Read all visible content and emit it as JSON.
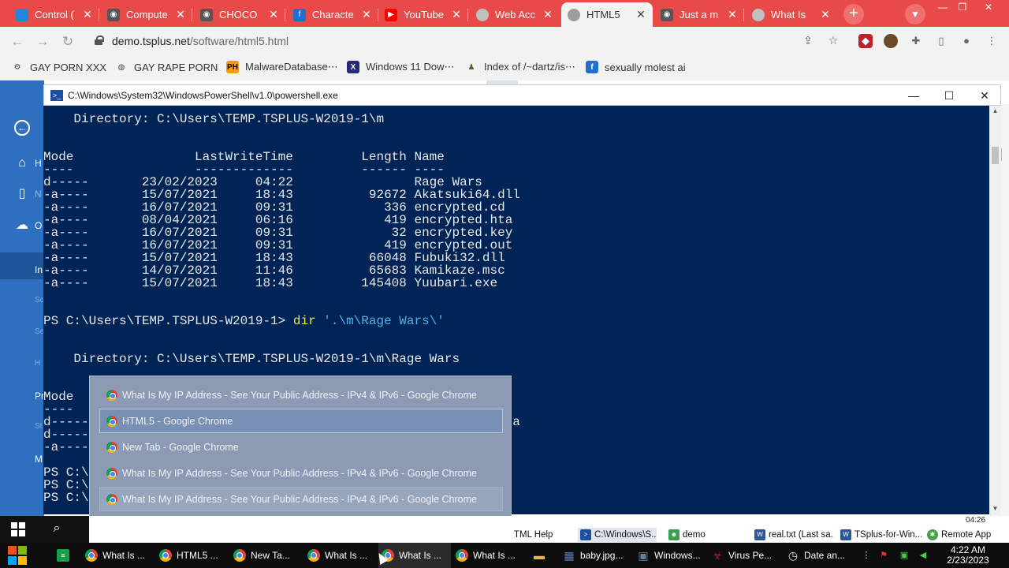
{
  "browser": {
    "tabs": [
      {
        "title": "Control (",
        "favicon_color": "#1f88d8",
        "active": false
      },
      {
        "title": "Compute",
        "favicon_color": "#555555",
        "active": false
      },
      {
        "title": "CHOCO",
        "favicon_color": "#555555",
        "active": false
      },
      {
        "title": "Characte",
        "favicon_color": "#1f6fd0",
        "active": false
      },
      {
        "title": "YouTube",
        "favicon_color": "#ff0000",
        "active": false
      },
      {
        "title": "Web Acc",
        "favicon_color": "#c0c0c0",
        "active": false
      },
      {
        "title": "HTML5",
        "favicon_color": "#9e9e9e",
        "active": true
      },
      {
        "title": "Just a m",
        "favicon_color": "#555555",
        "active": false
      },
      {
        "title": "What Is",
        "favicon_color": "#c0c0c0",
        "active": false
      }
    ],
    "new_tab_label": "+",
    "address": {
      "host": "demo.tsplus.net",
      "path": "/software/html5.html"
    },
    "bookmarks": [
      {
        "label": "GAY PORN XXX",
        "icon": "gear-icon"
      },
      {
        "label": "GAY RAPE PORN",
        "icon": "globe-icon"
      },
      {
        "label": "MalwareDatabase⋯",
        "icon": "ph-icon"
      },
      {
        "label": "Windows 11 Dow⋯",
        "icon": "x-icon"
      },
      {
        "label": "Index of /~dartz/is⋯",
        "icon": "figure-icon"
      },
      {
        "label": "sexually molest ai",
        "icon": "bookmark-icon"
      }
    ]
  },
  "remote_page": {
    "nav_labels": [
      "H",
      "N",
      "O",
      "In",
      "Sc",
      "Se",
      "H",
      "Pr",
      "St",
      "M"
    ]
  },
  "powershell": {
    "title": "C:\\Windows\\System32\\WindowsPowerShell\\v1.0\\powershell.exe",
    "lines": [
      {
        "text": "    Directory: C:\\Users\\TEMP.TSPLUS-W2019-1\\m"
      },
      {
        "text": ""
      },
      {
        "text": ""
      },
      {
        "text": "Mode                LastWriteTime         Length Name"
      },
      {
        "text": "----                -------------         ------ ----"
      },
      {
        "text": "d-----       23/02/2023     04:22                Rage Wars"
      },
      {
        "text": "-a----       15/07/2021     18:43          92672 Akatsuki64.dll"
      },
      {
        "text": "-a----       16/07/2021     09:31            336 encrypted.cd"
      },
      {
        "text": "-a----       08/04/2021     06:16            419 encrypted.hta"
      },
      {
        "text": "-a----       16/07/2021     09:31             32 encrypted.key"
      },
      {
        "text": "-a----       16/07/2021     09:31            419 encrypted.out"
      },
      {
        "text": "-a----       15/07/2021     18:43          66048 Fubuki32.dll"
      },
      {
        "text": "-a----       14/07/2021     11:46          65683 Kamikaze.msc"
      },
      {
        "text": "-a----       15/07/2021     18:43         145408 Yuubari.exe"
      },
      {
        "text": ""
      },
      {
        "text": ""
      },
      {
        "prompt": "PS C:\\Users\\TEMP.TSPLUS-W2019-1> ",
        "cmd": "dir",
        "arg": " '.\\m\\Rage Wars\\'"
      },
      {
        "text": ""
      },
      {
        "text": ""
      },
      {
        "text": "    Directory: C:\\Users\\TEMP.TSPLUS-W2019-1\\m\\Rage Wars"
      },
      {
        "text": ""
      },
      {
        "text": ""
      },
      {
        "text": "Mode"
      },
      {
        "text": "----"
      },
      {
        "text": "d-----                                                      ata"
      },
      {
        "text": "d-----"
      },
      {
        "text": "-a----"
      },
      {
        "text": ""
      },
      {
        "text": "PS C:\\"
      },
      {
        "text": "PS C:\\"
      },
      {
        "text": "PS C:\\"
      }
    ]
  },
  "window_list": {
    "items": [
      {
        "label": "What Is My IP Address - See Your Public Address - IPv4 & IPv6 - Google Chrome",
        "state": "normal"
      },
      {
        "label": "HTML5 - Google Chrome",
        "state": "selected"
      },
      {
        "label": "New Tab - Google Chrome",
        "state": "normal"
      },
      {
        "label": "What Is My IP Address - See Your Public Address - IPv4 & IPv6 - Google Chrome",
        "state": "normal"
      },
      {
        "label": "What Is My IP Address - See Your Public Address - IPv4 & IPv6 - Google Chrome",
        "state": "hover"
      },
      {
        "label": "What Is My IP Address - See Your Public Address - IPv4 & IPv6 - Google Chrome",
        "state": "normal"
      }
    ]
  },
  "remote_taskbar": {
    "time": "04:26",
    "items": [
      {
        "label": "TML Help",
        "icon_color": "#2a7ad8"
      },
      {
        "label": "C:\\Windows\\S...",
        "icon_color": "#1e4ea0",
        "active": true
      },
      {
        "label": "demo",
        "icon_color": "#3aa050"
      },
      {
        "label": "real.txt (Last sa...",
        "icon_color": "#2b5797"
      },
      {
        "label": "TSplus-for-Win...",
        "icon_color": "#2b5797"
      },
      {
        "label": "Remote App",
        "icon_color": "#4a9e4a"
      }
    ]
  },
  "host_taskbar": {
    "items": [
      {
        "label": "What Is ...",
        "icon": "chrome-icon"
      },
      {
        "label": "HTML5 ...",
        "icon": "chrome-icon"
      },
      {
        "label": "New Ta...",
        "icon": "chrome-icon"
      },
      {
        "label": "What Is ...",
        "icon": "chrome-icon"
      },
      {
        "label": "What Is ...",
        "icon": "chrome-icon",
        "active": true
      },
      {
        "label": "What Is ...",
        "icon": "chrome-icon"
      },
      {
        "label": "",
        "icon": "folder-icon"
      },
      {
        "label": "baby.jpg...",
        "icon": "image-icon"
      },
      {
        "label": "Windows...",
        "icon": "window-icon"
      },
      {
        "label": "Virus Pe...",
        "icon": "virus-icon"
      },
      {
        "label": "Date an...",
        "icon": "clock-icon"
      }
    ],
    "clock_time": "4:22 AM",
    "clock_date": "2/23/2023"
  }
}
